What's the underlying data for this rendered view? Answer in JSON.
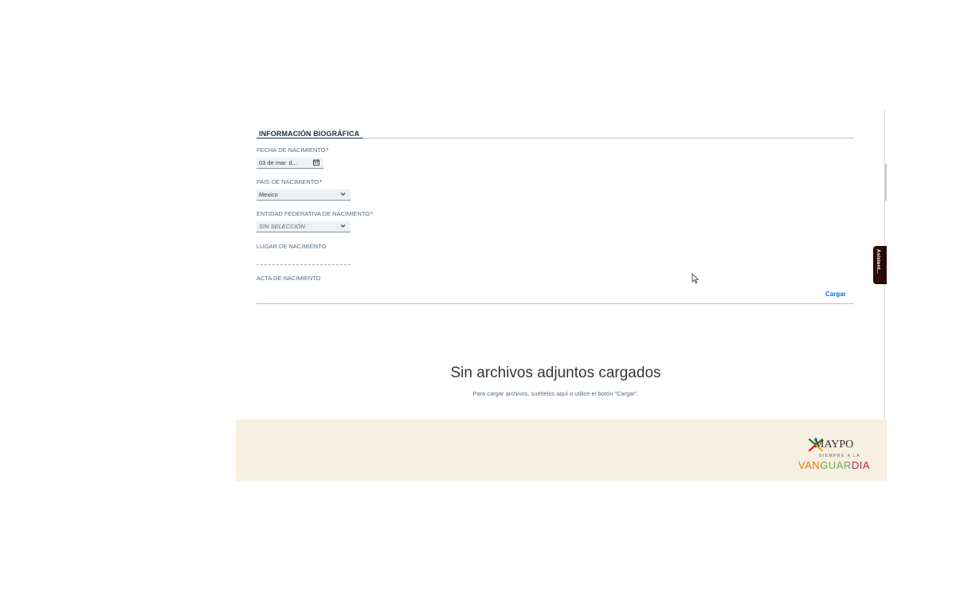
{
  "section": {
    "title": "INFORMACIÓN BIOGRÁFICA"
  },
  "fields": {
    "birth_date": {
      "label": "FECHA DE NACIMIENTO",
      "required": "*",
      "value": "03 de mar. d...",
      "icon": "calendar-icon"
    },
    "birth_country": {
      "label": "PAIS DE NACIMIENTO",
      "required": "*",
      "value": "Mexico",
      "icon": "chevron-down-icon"
    },
    "birth_state": {
      "label": "ENTIDAD FEDERATIVA DE NACIMIENTO",
      "required": "*",
      "value": "SIN SELECCIÓN",
      "icon": "chevron-down-icon"
    },
    "birth_place": {
      "label": "LUGAR DE NACIMIENTO",
      "value": ""
    },
    "birth_certificate": {
      "label": "ACTA DE NACIMIENTO",
      "upload_label": "Cargar"
    }
  },
  "attachments": {
    "empty_title": "Sin archivos adjuntos cargados",
    "empty_hint": "Para cargar archivos, suéltelos aquí o utilice el botón \"Cargar\"."
  },
  "footer": {
    "logo_name": "MAYPO",
    "logo_tagline": "SIEMPRE A LA",
    "logo_slogan": "VANGUARDIA"
  },
  "side_tab": {
    "label": "Asistent..."
  },
  "colors": {
    "required": "#bb0000",
    "link": "#0a6ed1",
    "footer_bg": "#f6f0e2"
  }
}
